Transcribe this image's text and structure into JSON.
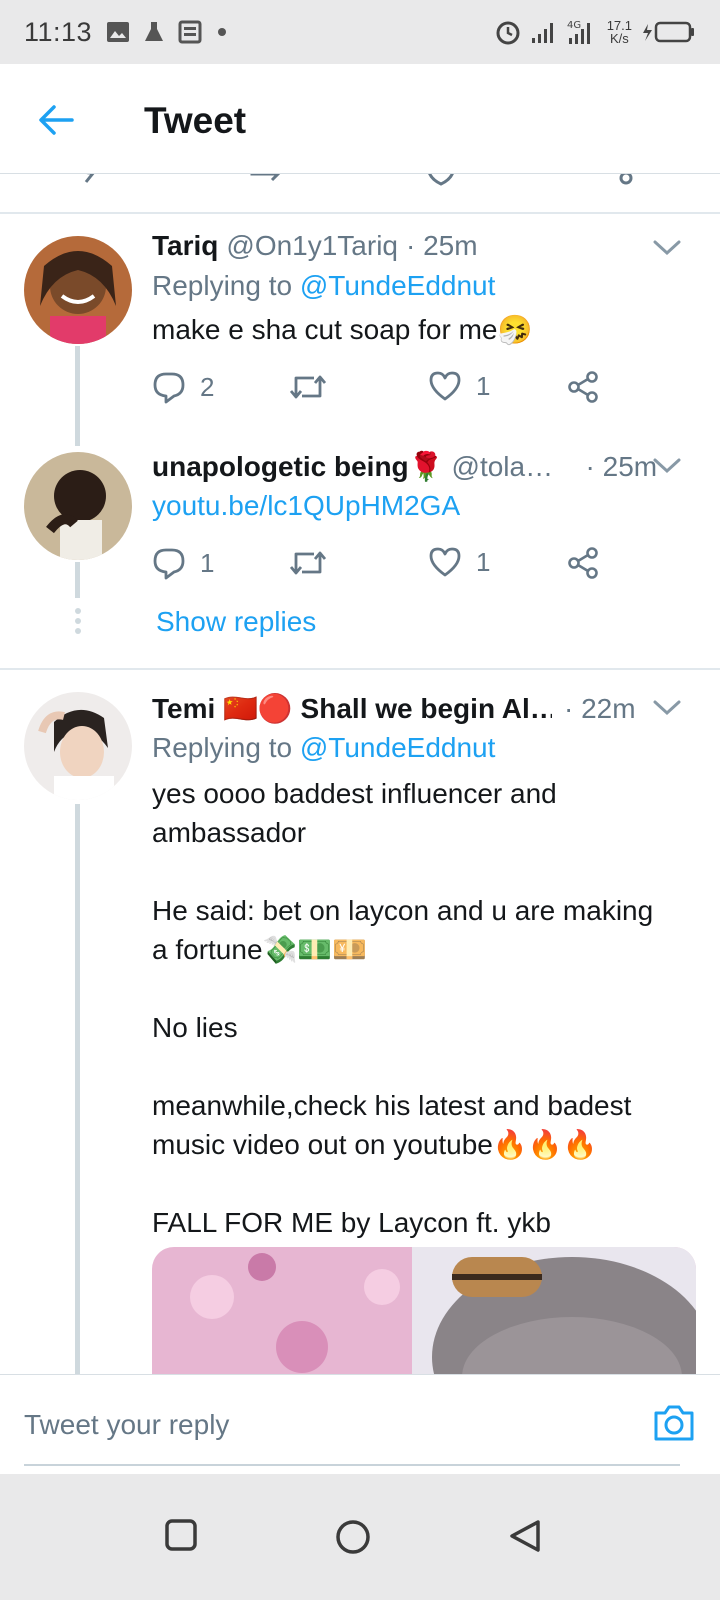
{
  "status_bar": {
    "time": "11:13",
    "net_speed_value": "17.1",
    "net_speed_unit": "K/s",
    "left_icons": [
      "image-icon",
      "flask-icon",
      "news-icon",
      "dot-icon"
    ],
    "right_icons": [
      "alarm-icon",
      "signal-icon",
      "signal-4g-icon",
      "battery-charging-icon"
    ]
  },
  "app_bar": {
    "title": "Tweet",
    "back_icon": "arrow-left-icon"
  },
  "tweets": [
    {
      "name": "Tariq",
      "handle": "@On1y1Tariq",
      "time": "· 25m",
      "replying_prefix": "Replying to ",
      "replying_to": "@TundeEddnut",
      "text": "make e sha cut soap for me🤧",
      "replies": "2",
      "retweets": "",
      "likes": "1"
    },
    {
      "name": "unapologetic being🌹",
      "handle": "@tola…",
      "time": "· 25m",
      "link": "youtu.be/lc1QUpHM2GA",
      "replies": "1",
      "retweets": "",
      "likes": "1",
      "show_replies": "Show replies"
    },
    {
      "name": "Temi 🇨🇳🔴 Shall we begin Al…",
      "handle": "",
      "time": "· 22m",
      "replying_prefix": "Replying to ",
      "replying_to": "@TundeEddnut",
      "text": "yes oooo baddest influencer and\nambassador\n\nHe said: bet on laycon and u are making\na fortune💸💵💴\n\nNo lies\n\nmeanwhile,check his latest and badest\nmusic video out on youtube🔥🔥🔥\n\nFALL FOR ME by Laycon ft. ykb"
    }
  ],
  "composer": {
    "placeholder": "Tweet your reply",
    "camera_icon": "camera-icon"
  },
  "nav_bar": {
    "icons": [
      "recents-square-icon",
      "home-circle-icon",
      "back-triangle-icon"
    ]
  },
  "colors": {
    "accent": "#1da1f2",
    "secondary_text": "#657786",
    "thread_line": "#cfd9de"
  }
}
